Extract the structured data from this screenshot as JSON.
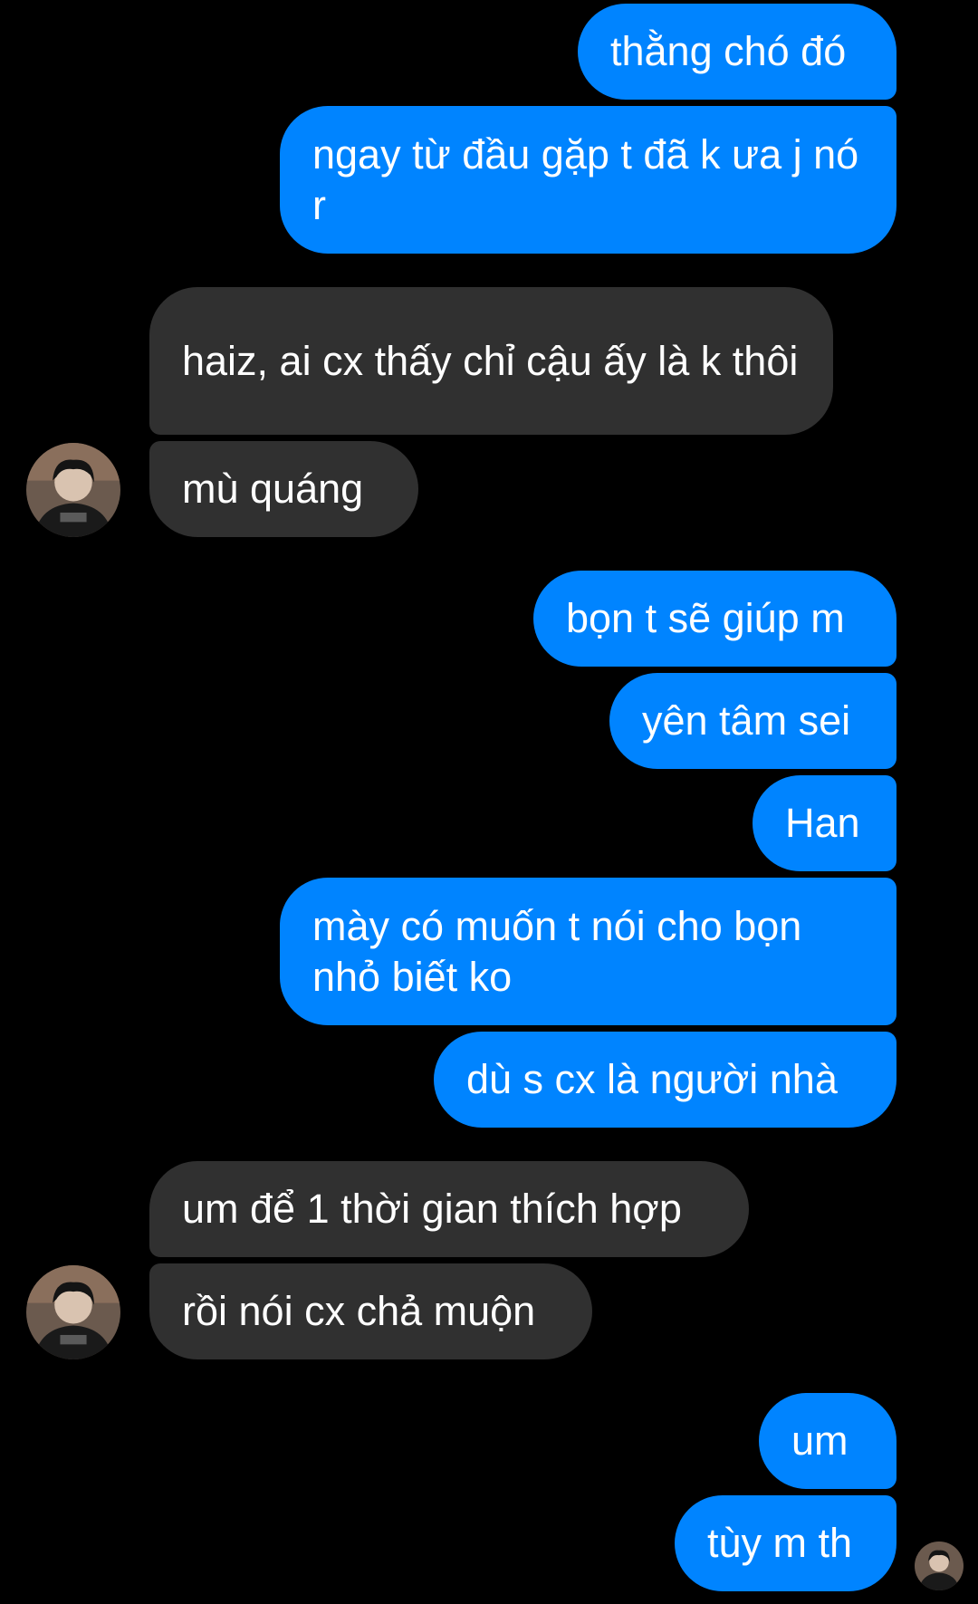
{
  "colors": {
    "background": "#000000",
    "outgoing_bubble": "#0084ff",
    "incoming_bubble": "#303030",
    "text": "#ffffff"
  },
  "conversation": {
    "messages": [
      {
        "id": "m1",
        "direction": "outgoing",
        "text": "thằng chó đó"
      },
      {
        "id": "m2",
        "direction": "outgoing",
        "text": "ngay từ đầu gặp t đã k ưa j nó r"
      },
      {
        "id": "m3",
        "direction": "incoming",
        "text": "haiz, ai cx thấy chỉ cậu ấy là k thôi"
      },
      {
        "id": "m4",
        "direction": "incoming",
        "text": "mù quáng"
      },
      {
        "id": "m5",
        "direction": "outgoing",
        "text": "bọn t sẽ giúp m"
      },
      {
        "id": "m6",
        "direction": "outgoing",
        "text": "yên tâm sei"
      },
      {
        "id": "m7",
        "direction": "outgoing",
        "text": "Han"
      },
      {
        "id": "m8",
        "direction": "outgoing",
        "text": "mày có muốn t nói cho bọn nhỏ biết ko"
      },
      {
        "id": "m9",
        "direction": "outgoing",
        "text": "dù s cx là người nhà"
      },
      {
        "id": "m10",
        "direction": "incoming",
        "text": "um để 1 thời gian thích hợp"
      },
      {
        "id": "m11",
        "direction": "incoming",
        "text": "rồi nói cx chả muộn"
      },
      {
        "id": "m12",
        "direction": "outgoing",
        "text": "um"
      },
      {
        "id": "m13",
        "direction": "outgoing",
        "text": "tùy m th"
      }
    ]
  }
}
